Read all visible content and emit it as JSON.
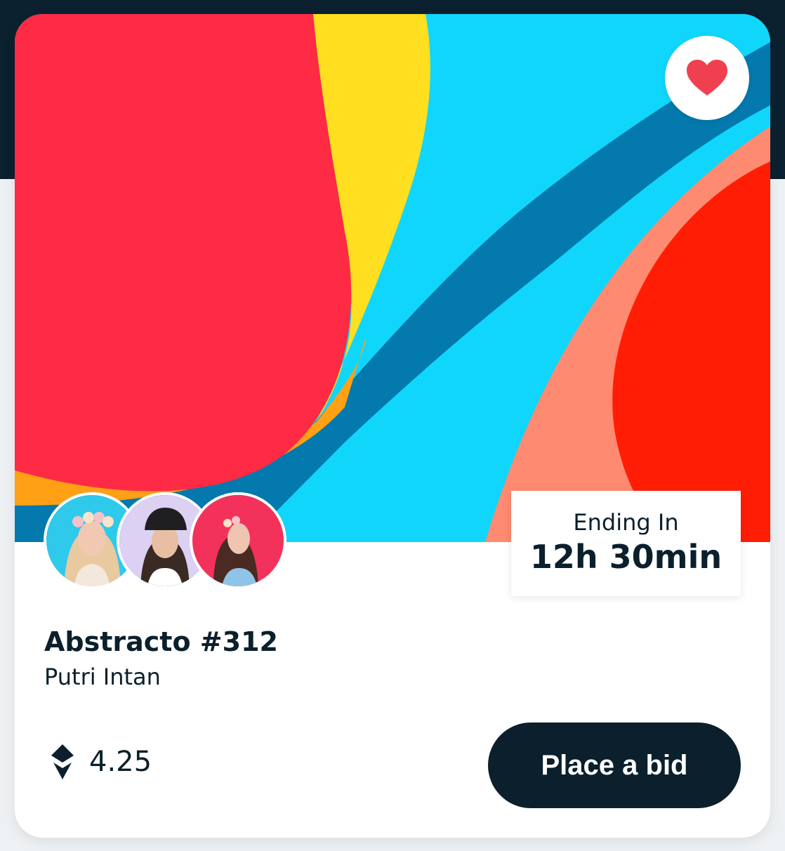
{
  "nft": {
    "title": "Abstracto #312",
    "artist": "Putri Intan",
    "price": "4.25",
    "ending_label": "Ending In",
    "ending_value": "12h 30min",
    "bid_label": "Place a bid",
    "favorited": true
  },
  "icons": {
    "favorite": "heart-icon",
    "currency": "ethereum-icon"
  },
  "colors": {
    "dark": "#0b1f2c",
    "heart": "#f0404f",
    "art_red": "#ff2a44",
    "art_yellow": "#ffdf1f",
    "art_cyan": "#11d6fb",
    "art_blue": "#0379ad",
    "art_salmon": "#fe8a71",
    "art_bright_red": "#ff1e05"
  }
}
